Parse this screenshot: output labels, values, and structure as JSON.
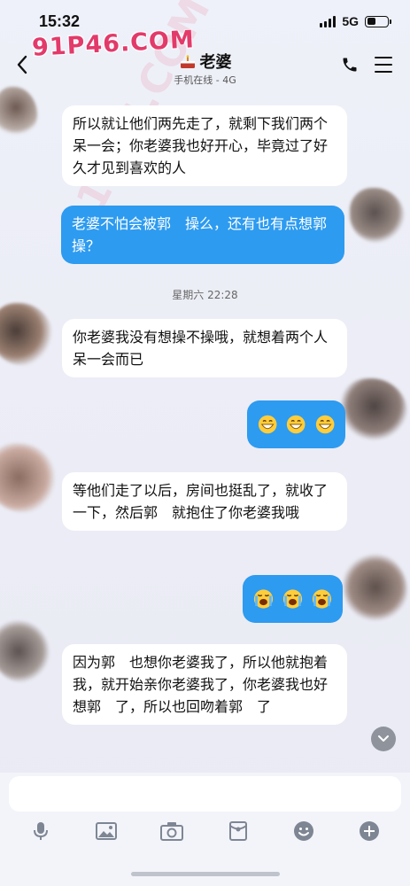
{
  "status_bar": {
    "time": "15:32",
    "network": "5G",
    "battery_level": 0.45
  },
  "watermark": "91P46.COM",
  "header": {
    "title": "老婆",
    "subtitle": "手机在线 - 4G",
    "title_emoji": "cake-icon"
  },
  "messages": [
    {
      "side": "in",
      "text": "所以就让他们两先走了，就剩下我们两个呆一会；你老婆我也好开心，毕竟过了好久才见到喜欢的人"
    },
    {
      "side": "out",
      "text": "老婆不怕会被郭　操么，还有也有点想郭　操？"
    },
    {
      "side": "in",
      "text": "你老婆我没有想操不操哦，就想着两个人呆一会而已"
    },
    {
      "side": "out",
      "emoji": [
        "grinning-face-icon",
        "grinning-face-icon",
        "grinning-face-icon"
      ]
    },
    {
      "side": "in",
      "text": "等他们走了以后，房间也挺乱了，就收了一下，然后郭　就抱住了你老婆我哦"
    },
    {
      "side": "out",
      "emoji": [
        "loudly-crying-face-icon",
        "loudly-crying-face-icon",
        "loudly-crying-face-icon"
      ]
    },
    {
      "side": "in",
      "text": "因为郭　也想你老婆我了，所以他就抱着我，就开始亲你老婆我了，你老婆我也好想郭　了，所以也回吻着郭　了"
    }
  ],
  "timestamp": "星期六 22:28",
  "input": {
    "placeholder": ""
  },
  "toolbar": [
    "microphone-icon",
    "image-icon",
    "camera-icon",
    "red-packet-icon",
    "smiley-icon",
    "plus-icon"
  ],
  "colors": {
    "outgoing_bubble": "#2d9bf0",
    "incoming_bubble": "#ffffff",
    "watermark": "#e23a6a"
  }
}
